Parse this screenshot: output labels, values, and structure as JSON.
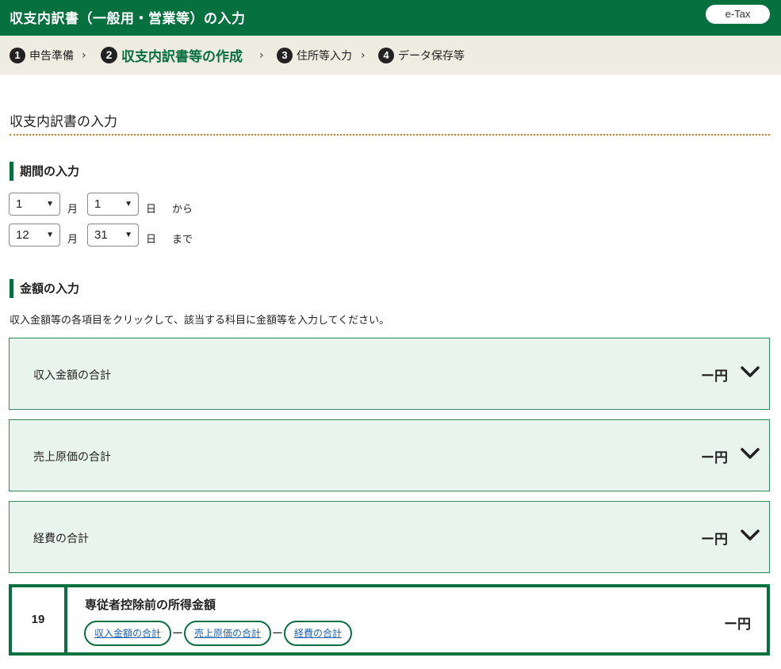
{
  "header": {
    "title": "収支内訳書（一般用・営業等）の入力",
    "etax_label": "e-Tax"
  },
  "steps": [
    {
      "num": "1",
      "label": "申告準備"
    },
    {
      "num": "2",
      "label": "収支内訳書等の作成"
    },
    {
      "num": "3",
      "label": "住所等入力"
    },
    {
      "num": "4",
      "label": "データ保存等"
    }
  ],
  "step_separator": "›",
  "page": {
    "heading": "収支内訳書の入力"
  },
  "period": {
    "heading": "期間の入力",
    "from": {
      "month": "1",
      "day": "1",
      "month_unit": "月",
      "day_unit": "日",
      "suffix": "から"
    },
    "to": {
      "month": "12",
      "day": "31",
      "month_unit": "月",
      "day_unit": "日",
      "suffix": "まで"
    }
  },
  "amount": {
    "heading": "金額の入力",
    "instruction": "収入金額等の各項目をクリックして、該当する科目に金額等を入力してください。",
    "sections": [
      {
        "label": "収入金額の合計",
        "value": "ー円"
      },
      {
        "label": "売上原価の合計",
        "value": "ー円"
      },
      {
        "label": "経費の合計",
        "value": "ー円"
      }
    ]
  },
  "result": {
    "no": "19",
    "title": "専従者控除前の所得金額",
    "value": "ー円",
    "formula": [
      "収入金額の合計",
      "売上原価の合計",
      "経費の合計"
    ],
    "operator": "ー"
  },
  "colors": {
    "brand_green": "#07703f",
    "section_bg": "#eaf4ee",
    "steps_bg": "#efece1",
    "rule_orange": "#d9741a",
    "link_blue": "#1d64b4"
  }
}
